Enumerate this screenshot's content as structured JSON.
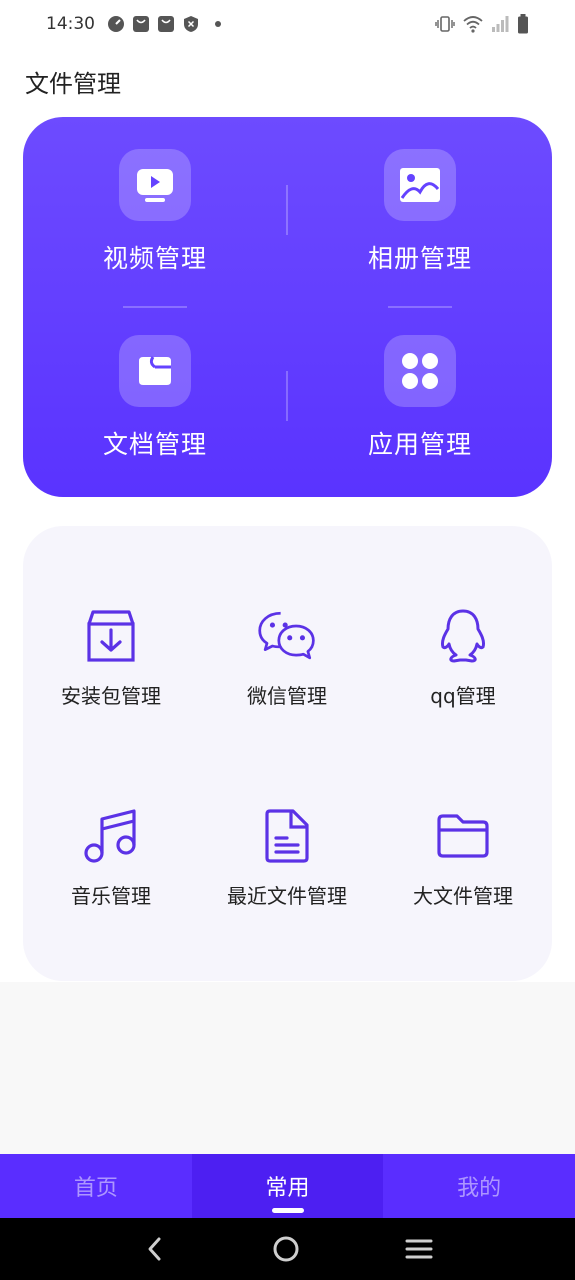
{
  "status_bar": {
    "time": "14:30",
    "left_icons": [
      "speedometer-icon",
      "shopping-bag-icon",
      "shopping-bag-icon",
      "shield-icon",
      "dot-icon"
    ],
    "right_icons": [
      "vibrate-icon",
      "wifi-icon",
      "signal-icon",
      "battery-icon"
    ]
  },
  "page_title": "文件管理",
  "primary_tiles": [
    {
      "label": "视频管理",
      "icon": "video-icon"
    },
    {
      "label": "相册管理",
      "icon": "photo-icon"
    },
    {
      "label": "文档管理",
      "icon": "wallet-folder-icon"
    },
    {
      "label": "应用管理",
      "icon": "apps-icon"
    }
  ],
  "secondary_tiles": [
    {
      "label": "安装包管理",
      "icon": "package-icon"
    },
    {
      "label": "微信管理",
      "icon": "wechat-icon"
    },
    {
      "label": "qq管理",
      "icon": "qq-icon"
    },
    {
      "label": "音乐管理",
      "icon": "music-icon"
    },
    {
      "label": "最近文件管理",
      "icon": "document-icon"
    },
    {
      "label": "大文件管理",
      "icon": "folder-icon"
    }
  ],
  "bottom_nav": {
    "tabs": [
      {
        "label": "首页",
        "active": false
      },
      {
        "label": "常用",
        "active": true
      },
      {
        "label": "我的",
        "active": false
      }
    ]
  },
  "system_nav": [
    "back-icon",
    "home-icon",
    "recents-icon"
  ],
  "colors": {
    "accent": "#5a33ff",
    "accent_light": "#6d4bff",
    "icon_purple": "#5b32e6",
    "card_bg": "#f6f5fc",
    "nav_bg": "#5a2dff"
  }
}
